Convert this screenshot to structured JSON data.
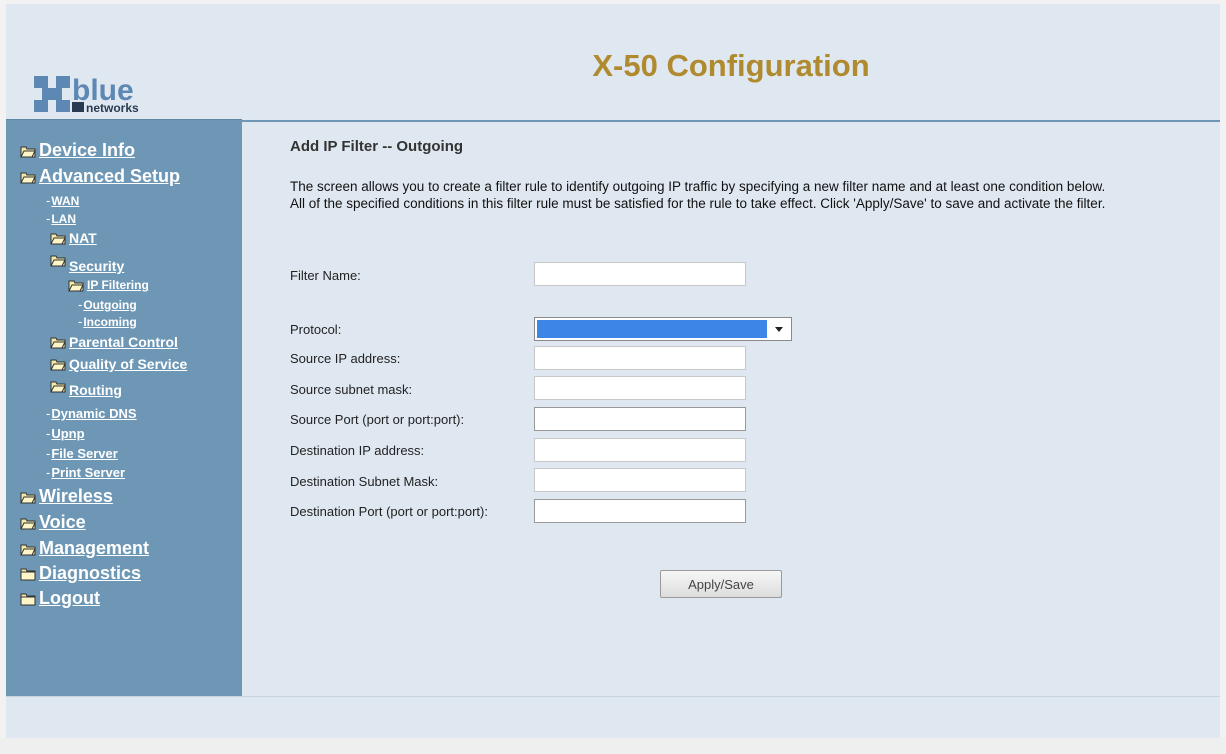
{
  "brand": {
    "logo_text": "blue",
    "logo_subtext": "networks"
  },
  "header": {
    "title": "X-50 Configuration"
  },
  "colors": {
    "sidebar": "#6e97b5",
    "title": "#b08a2e",
    "page_bg": "#dfe8f1",
    "select_highlight": "#3d86e8"
  },
  "sidebar": {
    "items": [
      {
        "label": "Device Info",
        "icon": "folder-open-icon"
      },
      {
        "label": "Advanced Setup",
        "icon": "folder-open-icon"
      },
      {
        "label": "WAN",
        "icon": "dash"
      },
      {
        "label": "LAN",
        "icon": "dash"
      },
      {
        "label": "NAT",
        "icon": "folder-open-icon"
      },
      {
        "label": "Security",
        "icon": "folder-open-icon"
      },
      {
        "label": "IP Filtering",
        "icon": "folder-open-icon"
      },
      {
        "label": "Outgoing",
        "icon": "dash"
      },
      {
        "label": "Incoming",
        "icon": "dash"
      },
      {
        "label": "Parental Control",
        "icon": "folder-open-icon"
      },
      {
        "label": "Quality of Service",
        "icon": "folder-open-icon"
      },
      {
        "label": "Routing",
        "icon": "folder-open-icon"
      },
      {
        "label": "Dynamic DNS",
        "icon": "dash"
      },
      {
        "label": "Upnp",
        "icon": "dash"
      },
      {
        "label": "File Server",
        "icon": "dash"
      },
      {
        "label": "Print Server",
        "icon": "dash"
      },
      {
        "label": "Wireless",
        "icon": "folder-open-icon"
      },
      {
        "label": "Voice",
        "icon": "folder-open-icon"
      },
      {
        "label": "Management",
        "icon": "folder-open-icon"
      },
      {
        "label": "Diagnostics",
        "icon": "folder-closed-icon"
      },
      {
        "label": "Logout",
        "icon": "folder-closed-icon"
      }
    ]
  },
  "main": {
    "title": "Add IP Filter -- Outgoing",
    "description": "The screen allows you to create a filter rule to identify outgoing IP traffic by specifying a new filter name and at least one condition below. All of the specified conditions in this filter rule must be satisfied for the rule to take effect. Click 'Apply/Save' to save and activate the filter.",
    "fields": {
      "filter_name": {
        "label": "Filter Name:",
        "value": ""
      },
      "protocol": {
        "label": "Protocol:",
        "value": ""
      },
      "src_ip": {
        "label": "Source IP address:",
        "value": ""
      },
      "src_mask": {
        "label": "Source subnet mask:",
        "value": ""
      },
      "src_port": {
        "label": "Source Port (port or port:port):",
        "value": ""
      },
      "dst_ip": {
        "label": "Destination IP address:",
        "value": ""
      },
      "dst_mask": {
        "label": "Destination Subnet Mask:",
        "value": ""
      },
      "dst_port": {
        "label": "Destination Port (port or port:port):",
        "value": ""
      }
    },
    "apply_label": "Apply/Save"
  }
}
